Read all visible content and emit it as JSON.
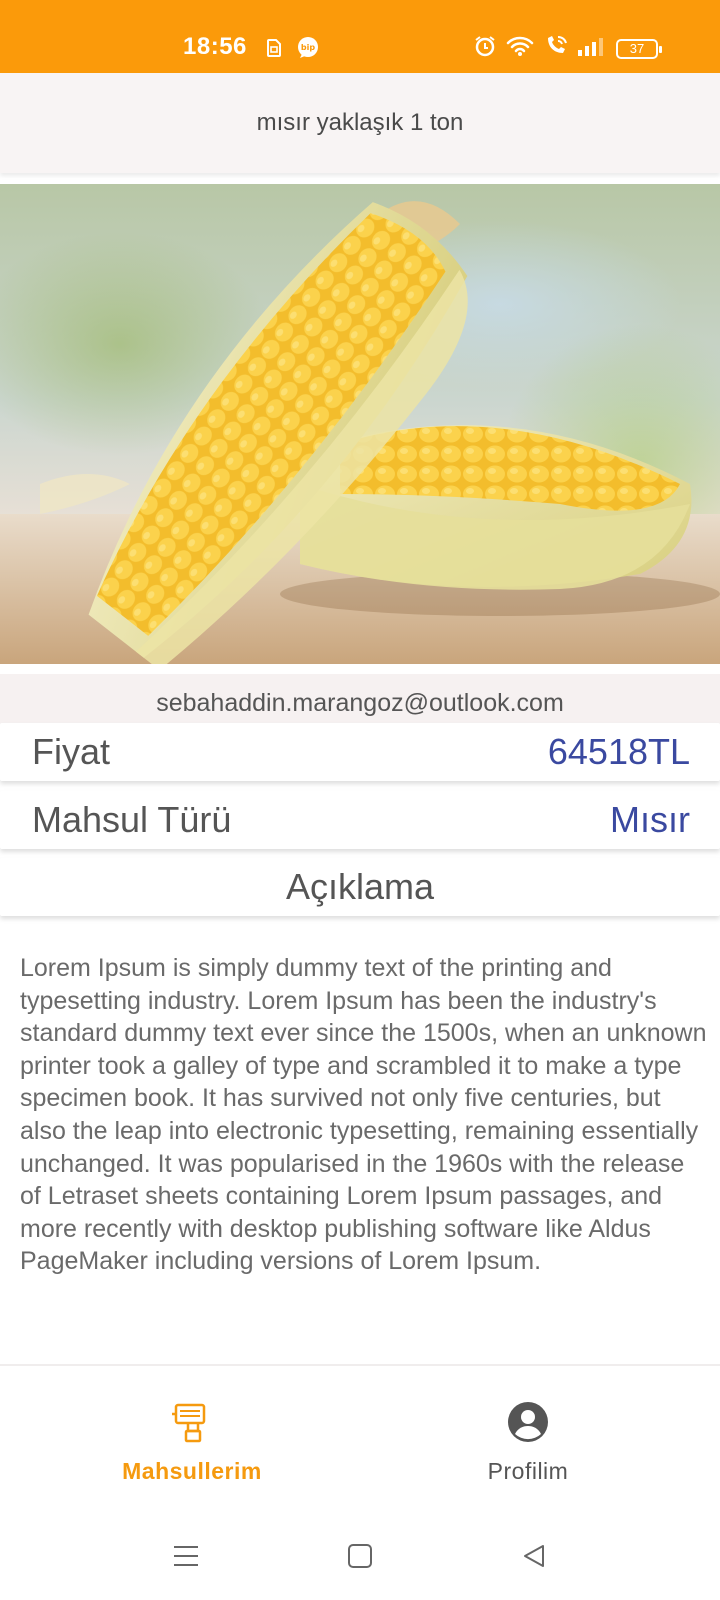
{
  "status_bar": {
    "time": "18:56",
    "battery": "37",
    "background": "#fb9a0a",
    "left_icons": [
      "sim-card-icon",
      "bip-icon"
    ],
    "right_icons": [
      "alarm-icon",
      "wifi-icon",
      "wifi-calling-icon",
      "signal-icon",
      "battery-icon"
    ]
  },
  "header": {
    "title": "mısır yaklaşık 1 ton"
  },
  "product": {
    "image_icon": "corn-photo",
    "email": "sebahaddin.marangoz@outlook.com",
    "price_label": "Fiyat",
    "price_value": "64518TL",
    "type_label": "Mahsul Türü",
    "type_value": "Mısır",
    "description_heading": "Açıklama",
    "description": "Lorem Ipsum is simply dummy text of the printing and typesetting industry. Lorem Ipsum has been the industry's standard dummy text ever since the 1500s, when an unknown printer took a galley of type and scrambled it to make a type specimen book. It has survived not only five centuries, but also the leap into electronic typesetting, remaining essentially unchanged. It was popularised in the 1960s with the release of Letraset sheets containing Lorem Ipsum passages, and more recently with desktop publishing software like Aldus PageMaker including versions of Lorem Ipsum.",
    "value_color": "#3a49a0"
  },
  "bottom_nav": {
    "items": [
      {
        "label": "Mahsullerim",
        "icon": "drill-icon",
        "active": true
      },
      {
        "label": "Profilim",
        "icon": "account-circle-icon",
        "active": false
      }
    ],
    "active_color": "#f59a0f"
  },
  "system_nav": {
    "buttons": [
      "menu-icon",
      "home-icon",
      "back-icon"
    ]
  }
}
